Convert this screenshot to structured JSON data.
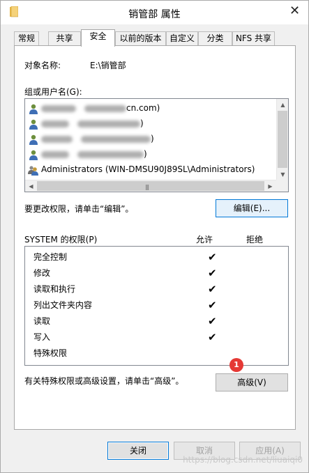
{
  "window": {
    "title": "销管部 属性",
    "close_glyph": "✕",
    "folder_icon": "folder-icon"
  },
  "tabs": [
    {
      "label": "常规",
      "active": false
    },
    {
      "label": "共享",
      "active": false
    },
    {
      "label": "安全",
      "active": true
    },
    {
      "label": "以前的版本",
      "active": false
    },
    {
      "label": "自定义",
      "active": false
    },
    {
      "label": "分类",
      "active": false
    },
    {
      "label": "NFS 共享",
      "active": false
    }
  ],
  "security": {
    "object_name_label": "对象名称:",
    "object_name_value": "E:\\销管部",
    "group_label": "组或用户名(G):",
    "users": [
      {
        "icon": "user-icon",
        "text": "",
        "suffix": "cn.com)",
        "redacted": true
      },
      {
        "icon": "user-icon",
        "text": "",
        "suffix": ")",
        "redacted": true
      },
      {
        "icon": "user-icon",
        "text": "",
        "suffix": ")",
        "redacted": true
      },
      {
        "icon": "user-icon",
        "text": "",
        "suffix": ")",
        "redacted": true
      },
      {
        "icon": "group-icon",
        "text": "Administrators (WIN-DMSU90J89SL\\Administrators)",
        "suffix": "",
        "redacted": false
      }
    ],
    "change_hint": "要更改权限，请单击“编辑”。",
    "edit_button": "编辑(E)...",
    "perm_header": "SYSTEM 的权限(P)",
    "allow_header": "允许",
    "deny_header": "拒绝",
    "permissions": [
      {
        "name": "完全控制",
        "allow": "✔"
      },
      {
        "name": "修改",
        "allow": "✔"
      },
      {
        "name": "读取和执行",
        "allow": "✔"
      },
      {
        "name": "列出文件夹内容",
        "allow": "✔"
      },
      {
        "name": "读取",
        "allow": "✔"
      },
      {
        "name": "写入",
        "allow": "✔"
      },
      {
        "name": "特殊权限",
        "allow": ""
      }
    ],
    "advanced_hint": "有关特殊权限或高级设置，请单击“高级”。",
    "advanced_button": "高级(V)",
    "annotation_badge": "1"
  },
  "footer": {
    "close_button": "关闭",
    "cancel_button": "取消",
    "apply_button": "应用(A)"
  },
  "watermark": "https://blog.csdn.net/liuaiqi0",
  "colors": {
    "accent": "#0078d7",
    "badge": "#e53935"
  }
}
